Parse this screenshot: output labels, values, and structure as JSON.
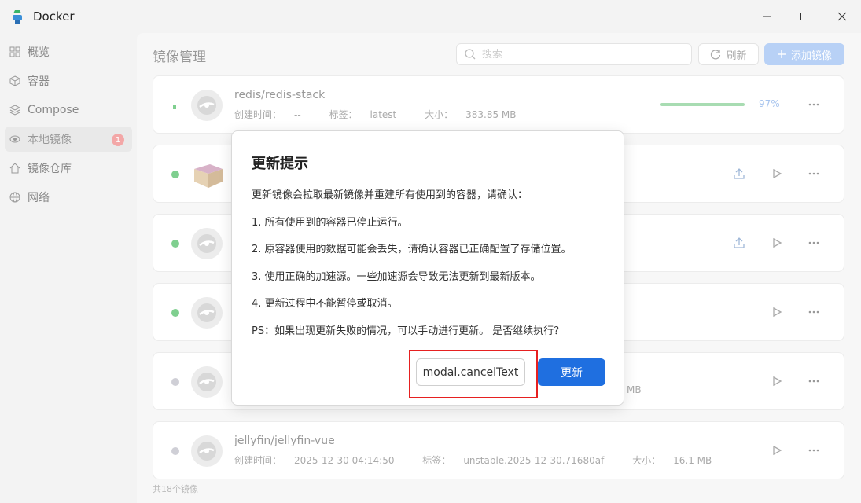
{
  "window": {
    "title": "Docker"
  },
  "sidebar": {
    "items": [
      {
        "label": "概览",
        "icon": "grid-icon"
      },
      {
        "label": "容器",
        "icon": "cube-icon"
      },
      {
        "label": "Compose",
        "icon": "layers-icon"
      },
      {
        "label": "本地镜像",
        "icon": "eye-icon",
        "badge": "1",
        "active": true
      },
      {
        "label": "镜像仓库",
        "icon": "home-icon"
      },
      {
        "label": "网络",
        "icon": "globe-icon"
      }
    ]
  },
  "header": {
    "title": "镜像管理",
    "search_placeholder": "搜索",
    "refresh_label": "刷新",
    "add_label": "添加镜像"
  },
  "images": [
    {
      "name": "redis/redis-stack",
      "created_label": "创建时间：",
      "created": "--",
      "tag_label": "标签：",
      "tag": "latest",
      "size_label": "大小：",
      "size": "383.85 MB",
      "progress": 97,
      "progress_text": "97%"
    },
    {
      "name": "jellyfin/jellyfin-vue",
      "created_label": "创建时间：",
      "created": "2025-12-30 04:14:50",
      "tag_label": "标签：",
      "tag": "unstable.2025-12-30.71680af",
      "size_label": "大小：",
      "size": "16.1 MB"
    }
  ],
  "partial_size_fragment": "MB",
  "footer": {
    "count_text": "共18个镜像"
  },
  "modal": {
    "title": "更新提示",
    "lines": [
      "更新镜像会拉取最新镜像并重建所有使用到的容器，请确认：",
      "1. 所有使用到的容器已停止运行。",
      "2. 原容器使用的数据可能会丢失，请确认容器已正确配置了存储位置。",
      "3. 使用正确的加速源。一些加速源会导致无法更新到最新版本。",
      "4. 更新过程中不能暂停或取消。",
      "PS：如果出现更新失败的情况，可以手动进行更新。 是否继续执行？"
    ],
    "cancel_label": "modal.cancelText",
    "confirm_label": "更新"
  },
  "colors": {
    "primary": "#1f6fe0",
    "highlight": "#e62020",
    "status_green": "#7fcf8f",
    "status_gray": "#cfcfd6",
    "badge": "#f3a7a7"
  }
}
